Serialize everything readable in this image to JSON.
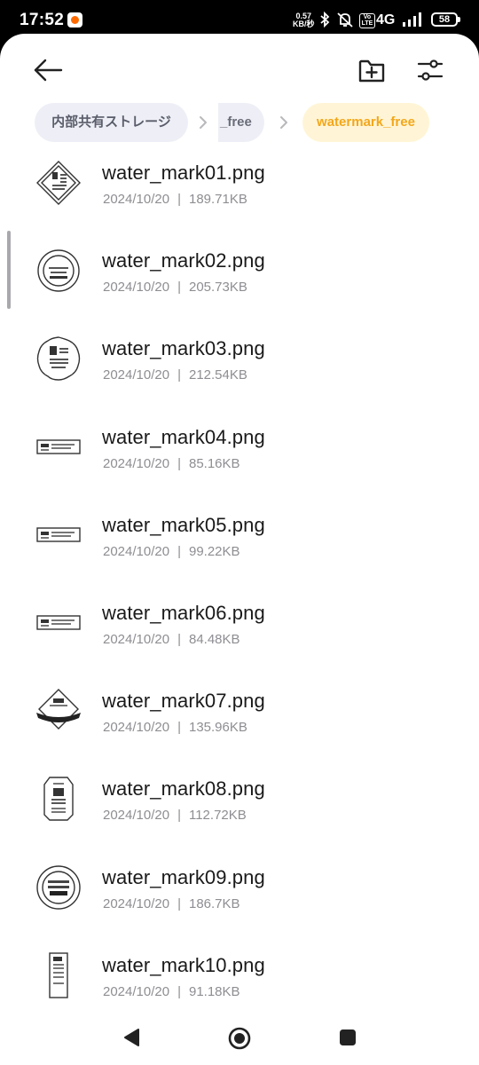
{
  "status_bar": {
    "time": "17:52",
    "net_speed_value": "0.57",
    "net_speed_unit": "KB/秒",
    "network": "4G",
    "volte": "Vo LTE",
    "battery": "58"
  },
  "toolbar": {
    "back_icon": "arrow-left-icon",
    "new_folder_icon": "folder-plus-icon",
    "filter_icon": "sliders-icon"
  },
  "breadcrumb": {
    "items": [
      {
        "label": "内部共有ストレージ"
      },
      {
        "label": "_free"
      },
      {
        "label": "watermark_free"
      }
    ],
    "active_color": "#f3a71b"
  },
  "files": [
    {
      "name": "water_mark01.png",
      "date": "2024/10/20",
      "size": "189.71KB",
      "thumb": "diamond-stamp"
    },
    {
      "name": "water_mark02.png",
      "date": "2024/10/20",
      "size": "205.73KB",
      "thumb": "round-stamp"
    },
    {
      "name": "water_mark03.png",
      "date": "2024/10/20",
      "size": "212.54KB",
      "thumb": "scalloped-stamp"
    },
    {
      "name": "water_mark04.png",
      "date": "2024/10/20",
      "size": "85.16KB",
      "thumb": "label-stamp"
    },
    {
      "name": "water_mark05.png",
      "date": "2024/10/20",
      "size": "99.22KB",
      "thumb": "label-stamp"
    },
    {
      "name": "water_mark06.png",
      "date": "2024/10/20",
      "size": "84.48KB",
      "thumb": "label-stamp"
    },
    {
      "name": "water_mark07.png",
      "date": "2024/10/20",
      "size": "135.96KB",
      "thumb": "diamond-banner-stamp"
    },
    {
      "name": "water_mark08.png",
      "date": "2024/10/20",
      "size": "112.72KB",
      "thumb": "tag-stamp"
    },
    {
      "name": "water_mark09.png",
      "date": "2024/10/20",
      "size": "186.7KB",
      "thumb": "round-text-stamp"
    },
    {
      "name": "water_mark10.png",
      "date": "2024/10/20",
      "size": "91.18KB",
      "thumb": "tall-label-stamp"
    }
  ],
  "meta_separator": "|",
  "nav": {
    "back_icon": "triangle-back-icon",
    "home_icon": "circle-home-icon",
    "recents_icon": "square-recents-icon"
  }
}
